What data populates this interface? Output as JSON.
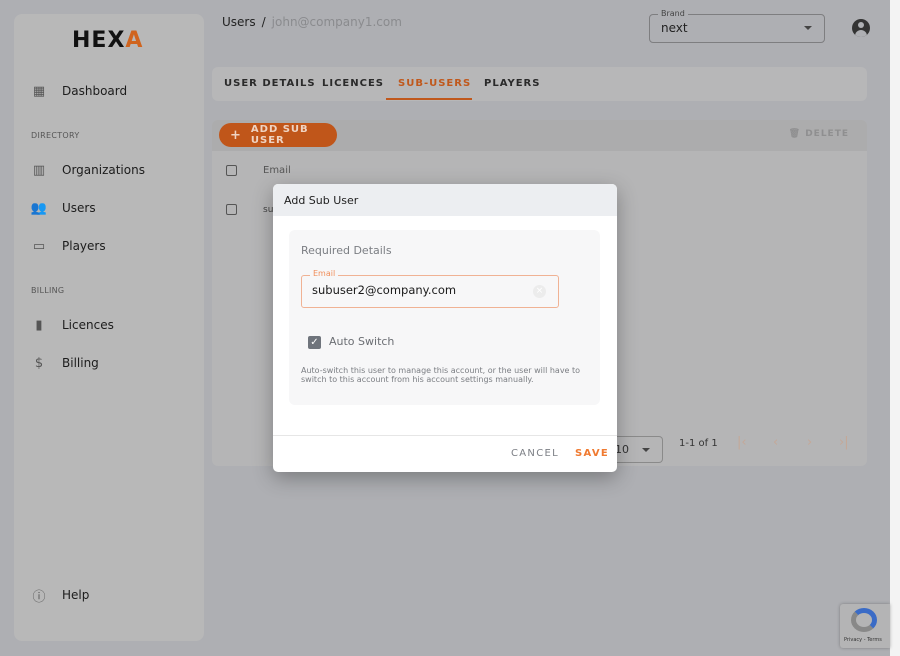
{
  "logo": {
    "text": "HEXA"
  },
  "sidebar": {
    "items": [
      {
        "label": "Dashboard",
        "icon": "dashboard-icon"
      },
      {
        "label": "Organizations",
        "icon": "building-icon"
      },
      {
        "label": "Users",
        "icon": "users-icon"
      },
      {
        "label": "Players",
        "icon": "monitor-icon"
      },
      {
        "label": "Licences",
        "icon": "book-icon"
      },
      {
        "label": "Billing",
        "icon": "dollar-icon"
      },
      {
        "label": "Help",
        "icon": "help-icon"
      }
    ],
    "sections": {
      "directory": "DIRECTORY",
      "billing": "BILLING"
    }
  },
  "breadcrumb": {
    "root": "Users",
    "separator": "/",
    "current": "john@company1.com"
  },
  "brand": {
    "label": "Brand",
    "value": "next"
  },
  "tabs": [
    {
      "label": "USER DETAILS"
    },
    {
      "label": "LICENCES"
    },
    {
      "label": "SUB-USERS",
      "active": true
    },
    {
      "label": "PLAYERS"
    }
  ],
  "toolbar": {
    "add_label": "ADD SUB USER",
    "delete_label": "DELETE"
  },
  "table": {
    "header": "Email",
    "rows": [
      {
        "email": "su"
      }
    ]
  },
  "pagination": {
    "rows_per_page": "10",
    "range": "1-1 of 1"
  },
  "dialog": {
    "title": "Add Sub User",
    "section": "Required Details",
    "email_label": "Email",
    "email_value": "subuser2@company.com",
    "auto_switch_label": "Auto Switch",
    "auto_switch_checked": true,
    "help_text": "Auto-switch this user to manage this account, or the user will have to switch to this account from his account settings manually.",
    "cancel_label": "CANCEL",
    "save_label": "SAVE"
  },
  "recaptcha": {
    "text": "Privacy - Terms"
  },
  "colors": {
    "accent": "#f07a30",
    "accent_dim": "#c0561a"
  }
}
